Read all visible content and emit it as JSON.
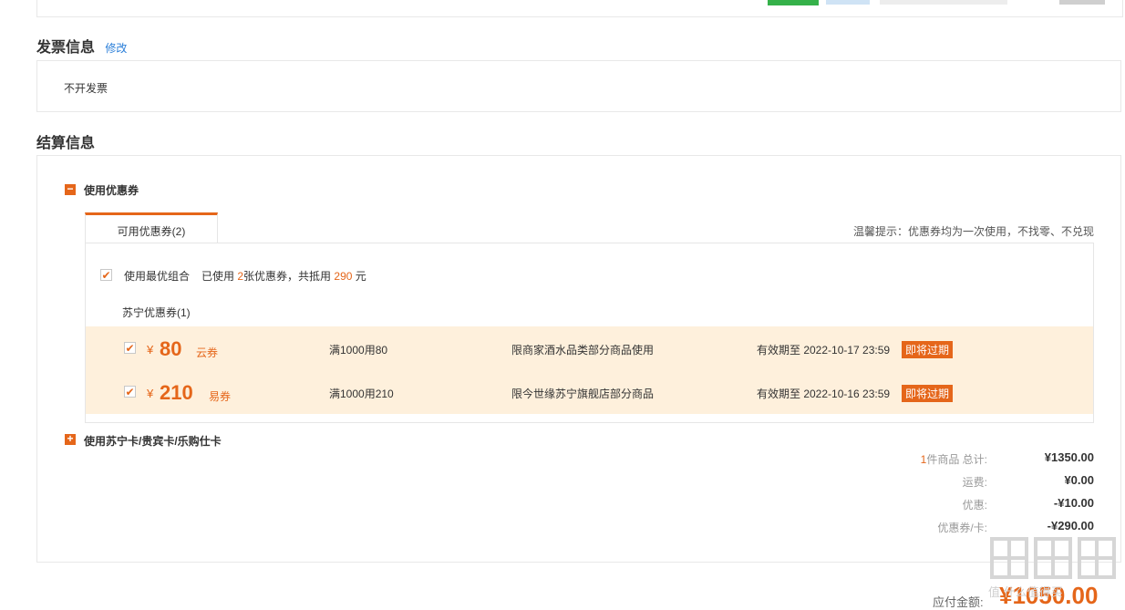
{
  "invoice": {
    "title": "发票信息",
    "edit_link": "修改",
    "value": "不开发票"
  },
  "settlement": {
    "title": "结算信息",
    "coupon_toggle": "使用优惠券",
    "tab_label": "可用优惠券(2)",
    "tip": "温馨提示：优惠券均为一次使用，不找零、不兑现",
    "best_combo": {
      "label": "使用最优组合",
      "used_prefix": "已使用",
      "used_count": "2",
      "used_mid": "张优惠券，共抵用",
      "amount": "290",
      "unit": "元"
    },
    "group_label": "苏宁优惠券(1)",
    "coupons": [
      {
        "currency": "¥",
        "amount": "80",
        "type": "云券",
        "rule": "满1000用80",
        "scope": "限商家酒水品类部分商品使用",
        "expiry": "有效期至 2022-10-17 23:59",
        "badge": "即将过期"
      },
      {
        "currency": "¥",
        "amount": "210",
        "type": "易券",
        "rule": "满1000用210",
        "scope": "限今世缘苏宁旗舰店部分商品",
        "expiry": "有效期至 2022-10-16 23:59",
        "badge": "即将过期"
      }
    ],
    "card_toggle": "使用苏宁卡/贵宾卡/乐购仕卡"
  },
  "summary": {
    "items_count": "1",
    "items_label": "件商品 总计:",
    "total": "¥1350.00",
    "shipping_label": "运费:",
    "shipping": "¥0.00",
    "discount_label": "优惠:",
    "discount": "-¥10.00",
    "coupon_label": "优惠券/卡:",
    "coupon_amount": "-¥290.00",
    "payable_label": "应付金额:",
    "payable": "¥1050.00"
  },
  "colors": {
    "accent": "#e5661a",
    "link": "#2b7fd9",
    "coupon_bg": "#fef0dc"
  },
  "watermark": "值 什么值得买"
}
